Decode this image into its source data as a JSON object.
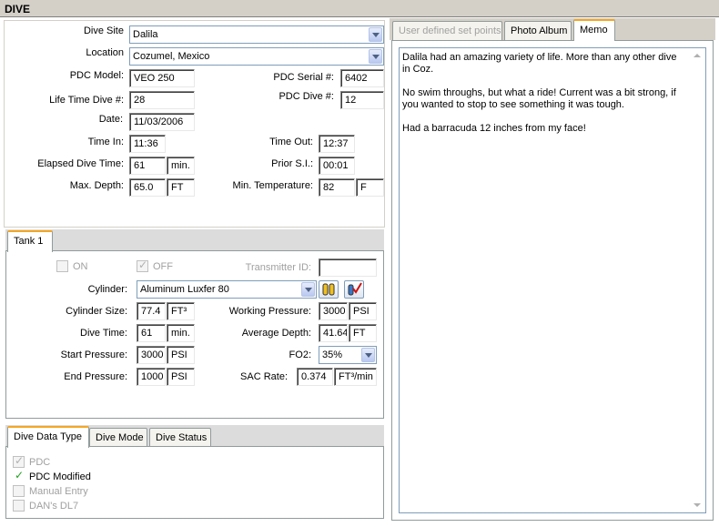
{
  "window": {
    "title": "DIVE"
  },
  "dive": {
    "dive_site": {
      "label": "Dive Site",
      "value": "Dalila"
    },
    "location": {
      "label": "Location",
      "value": "Cozumel, Mexico"
    },
    "pdc_model": {
      "label": "PDC Model:",
      "value": "VEO 250"
    },
    "pdc_serial": {
      "label": "PDC Serial #:",
      "value": "6402"
    },
    "life_time_dive": {
      "label": "Life Time Dive #:",
      "value": "28"
    },
    "pdc_dive": {
      "label": "PDC Dive #:",
      "value": "12"
    },
    "date": {
      "label": "Date:",
      "value": "11/03/2006"
    },
    "time_in": {
      "label": "Time In:",
      "value": "11:36"
    },
    "time_out": {
      "label": "Time Out:",
      "value": "12:37"
    },
    "elapsed": {
      "label": "Elapsed Dive Time:",
      "value": "61",
      "unit": "min."
    },
    "prior_si": {
      "label": "Prior S.I.:",
      "value": "00:01"
    },
    "max_depth": {
      "label": "Max. Depth:",
      "value": "65.0",
      "unit": "FT"
    },
    "min_temp": {
      "label": "Min. Temperature:",
      "value": "82",
      "unit": "F"
    }
  },
  "tank": {
    "tab_label": "Tank 1",
    "on_label": "ON",
    "on_checked": false,
    "off_label": "OFF",
    "off_checked": true,
    "transmitter": {
      "label": "Transmitter ID:",
      "value": ""
    },
    "cylinder": {
      "label": "Cylinder:",
      "value": "Aluminum Luxfer 80"
    },
    "cylinder_size": {
      "label": "Cylinder Size:",
      "value": "77.4",
      "unit": "FT³"
    },
    "working_pressure": {
      "label": "Working Pressure:",
      "value": "3000",
      "unit": "PSI"
    },
    "dive_time": {
      "label": "Dive Time:",
      "value": "61",
      "unit": "min."
    },
    "average_depth": {
      "label": "Average Depth:",
      "value": "41.64",
      "unit": "FT"
    },
    "start_pressure": {
      "label": "Start Pressure:",
      "value": "3000",
      "unit": "PSI"
    },
    "fo2": {
      "label": "FO2:",
      "value": "35%"
    },
    "end_pressure": {
      "label": "End Pressure:",
      "value": "1000",
      "unit": "PSI"
    },
    "sac_rate": {
      "label": "SAC Rate:",
      "value": "0.374",
      "unit": "FT³/min"
    }
  },
  "data_type": {
    "tabs": [
      "Dive Data Type",
      "Dive Mode",
      "Dive Status"
    ],
    "options": [
      {
        "label": "PDC",
        "checked": true,
        "enabled": false
      },
      {
        "label": "PDC Modified",
        "checked": true,
        "enabled": true
      },
      {
        "label": "Manual Entry",
        "checked": false,
        "enabled": false
      },
      {
        "label": "DAN's DL7",
        "checked": false,
        "enabled": false
      }
    ]
  },
  "right": {
    "tabs": [
      "User defined set points",
      "Photo Album",
      "Memo"
    ],
    "memo": [
      "Dalila had an amazing variety of life. More than any other dive in Coz.",
      "No swim throughs, but what a ride! Current was a bit strong, if you wanted to stop to see something it was tough.",
      "Had a barracuda 12 inches from my face!"
    ]
  },
  "colors": {
    "active_tab_accent": "#f5a623",
    "title_bar": "#d4d0c8",
    "check_green": "#21a121"
  }
}
